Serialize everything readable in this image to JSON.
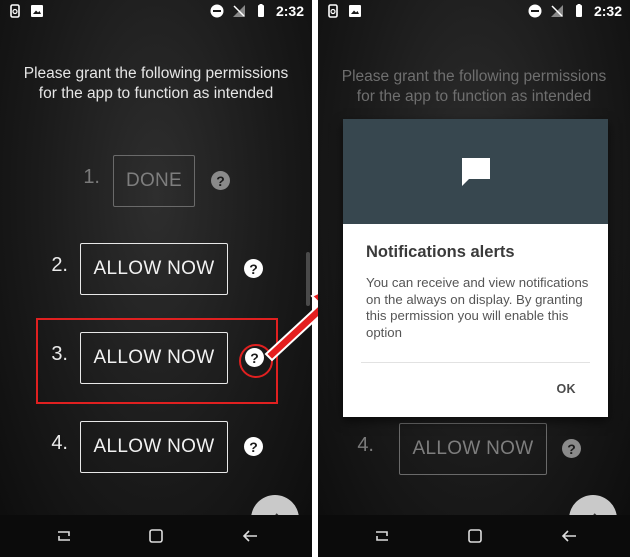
{
  "status_bar": {
    "time": "2:32"
  },
  "intro_text": "Please grant the following permissions for the app to function as intended",
  "permissions": [
    {
      "number": "1.",
      "button_label": "DONE",
      "state": "done"
    },
    {
      "number": "2.",
      "button_label": "ALLOW NOW",
      "state": "pending"
    },
    {
      "number": "3.",
      "button_label": "ALLOW NOW",
      "state": "pending"
    },
    {
      "number": "4.",
      "button_label": "ALLOW NOW",
      "state": "pending"
    }
  ],
  "help_glyph": "?",
  "dialog": {
    "title": "Notifications alerts",
    "body": "You can receive and view notifications on the always on display. By granting this permission you will enable this option",
    "ok_label": "OK"
  },
  "icons": {
    "fab": "arrow-right-icon",
    "nav": [
      "recent-apps-icon",
      "home-icon",
      "back-icon"
    ],
    "dialog_header": "chat-bubble-icon"
  },
  "colors": {
    "highlight": "#e02020",
    "dialog_header": "#37474f",
    "background": "#1a1a1a"
  }
}
